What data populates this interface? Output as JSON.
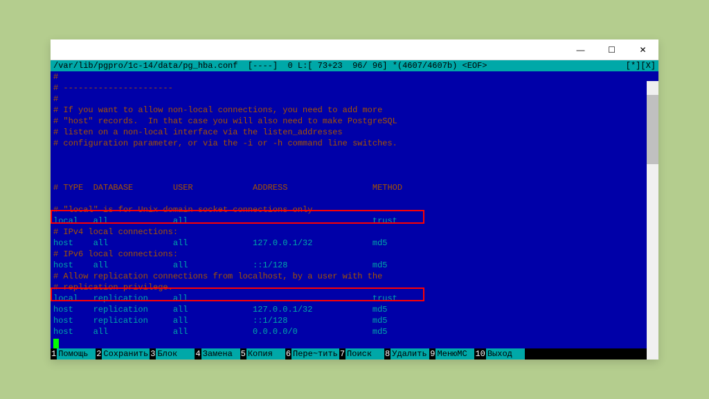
{
  "window": {
    "title": ""
  },
  "statusbar": {
    "path": "/var/lib/pgpro/1c-14/data/pg_hba.conf",
    "info": "  [----]  0 L:[ 73+23  96/ 96] *(4607/4607b) <EOF>",
    "right": "[*][X]"
  },
  "lines": {
    "l0": "#",
    "l1": "# ----------------------",
    "l2": "#",
    "l3": "# If you want to allow non-local connections, you need to add more",
    "l4": "# \"host\" records.  In that case you will also need to make PostgreSQL",
    "l5": "# listen on a non-local interface via the listen_addresses",
    "l6": "# configuration parameter, or via the -i or -h command line switches.",
    "l7": "",
    "l8": "",
    "l9": "",
    "l10": "# TYPE  DATABASE        USER            ADDRESS                 METHOD",
    "l11": "",
    "l12": "# \"local\" is for Unix domain socket connections only",
    "l13": "local   all             all                                     trust",
    "l14": "# IPv4 local connections:",
    "l15": "host    all             all             127.0.0.1/32            md5",
    "l16": "# IPv6 local connections:",
    "l17": "host    all             all             ::1/128                 md5",
    "l18": "# Allow replication connections from localhost, by a user with the",
    "l19": "# replication privilege.",
    "l20": "local   replication     all                                     trust",
    "l21": "host    replication     all             127.0.0.1/32            md5",
    "l22": "host    replication     all             ::1/128                 md5",
    "l23": "host    all             all             0.0.0.0/0               md5"
  },
  "fnbar": {
    "f1": {
      "num": "1",
      "label": "Помощь "
    },
    "f2": {
      "num": "2",
      "label": "Сохранить"
    },
    "f3": {
      "num": "3",
      "label": "Блок   "
    },
    "f4": {
      "num": "4",
      "label": "Замена "
    },
    "f5": {
      "num": "5",
      "label": "Копия  "
    },
    "f6": {
      "num": "6",
      "label": "Пере~тить"
    },
    "f7": {
      "num": "7",
      "label": "Поиск  "
    },
    "f8": {
      "num": "8",
      "label": "Удалить"
    },
    "f9": {
      "num": "9",
      "label": "МенюMC "
    },
    "f10": {
      "num": "10",
      "label": "Выход  "
    }
  },
  "controls": {
    "min": "—",
    "max": "☐",
    "close": "✕"
  }
}
